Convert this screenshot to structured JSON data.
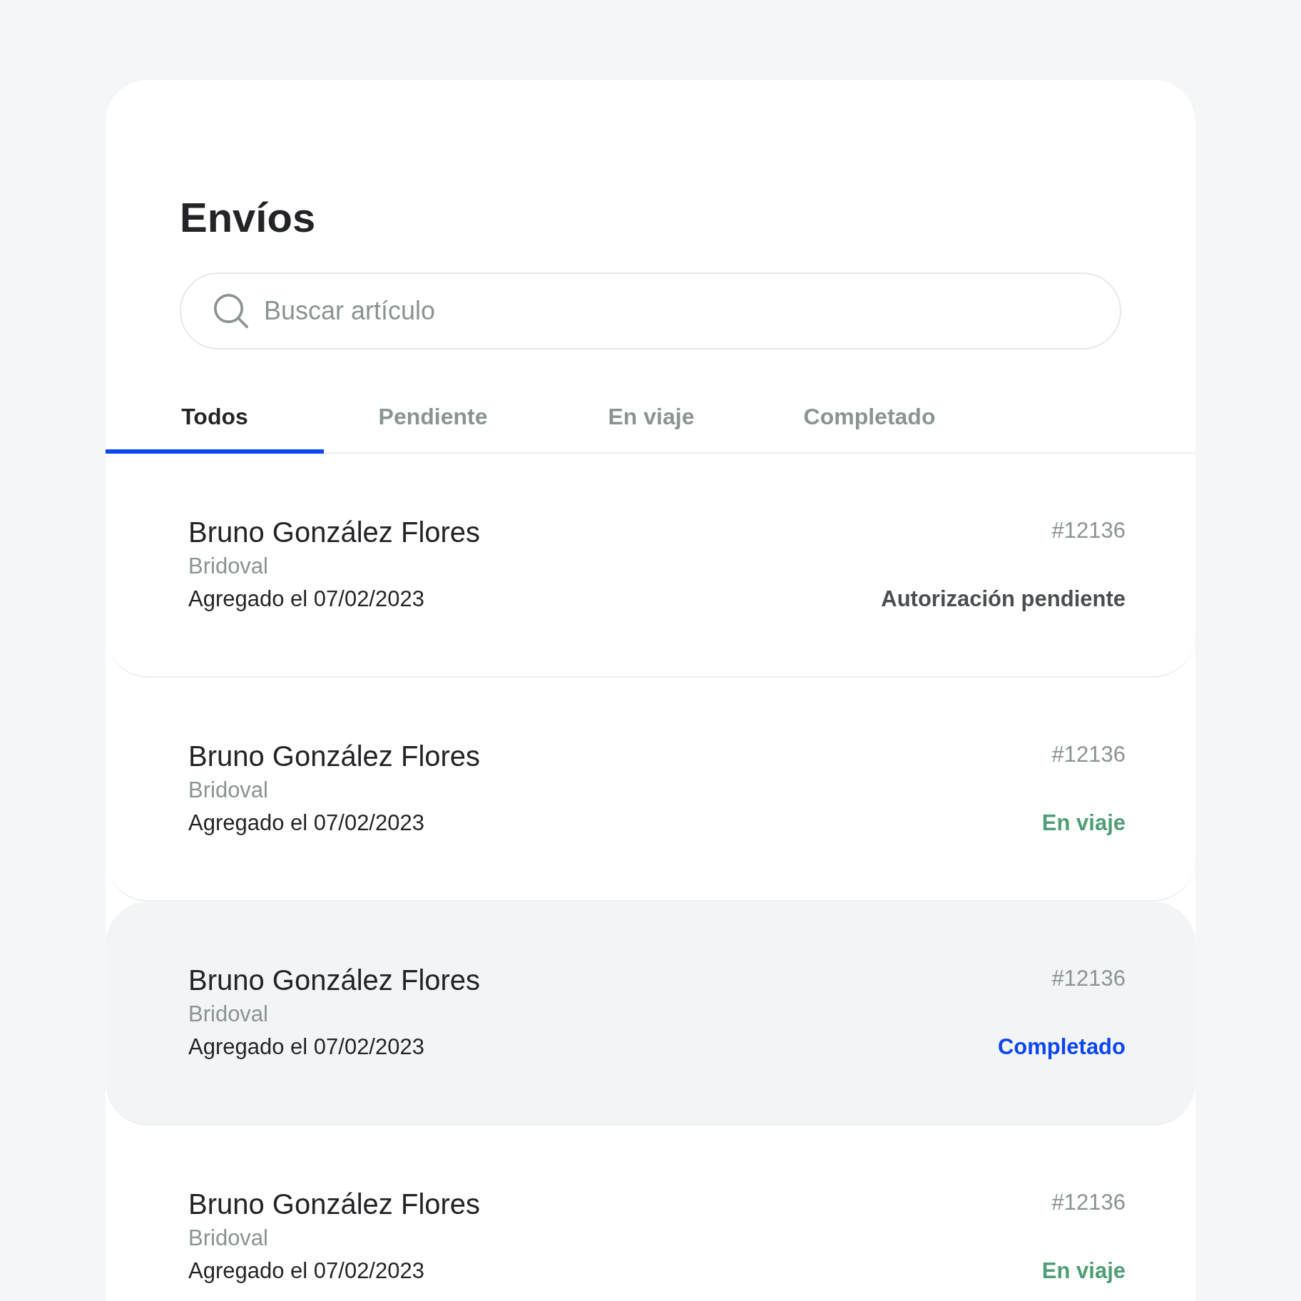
{
  "title": "Envíos",
  "search": {
    "placeholder": "Buscar artículo"
  },
  "tabs": [
    {
      "label": "Todos",
      "selected": true
    },
    {
      "label": "Pendiente",
      "selected": false
    },
    {
      "label": "En viaje",
      "selected": false
    },
    {
      "label": "Completado",
      "selected": false
    }
  ],
  "shipments": [
    {
      "name": "Bruno González Flores",
      "company": "Bridoval",
      "date": "Agregado el 07/02/2023",
      "number": "#12136",
      "status": "Autorización pendiente",
      "kind": "pending",
      "selected": false
    },
    {
      "name": "Bruno González Flores",
      "company": "Bridoval",
      "date": "Agregado el 07/02/2023",
      "number": "#12136",
      "status": "En viaje",
      "kind": "transit",
      "selected": false
    },
    {
      "name": "Bruno González Flores",
      "company": "Bridoval",
      "date": "Agregado el 07/02/2023",
      "number": "#12136",
      "status": "Completado",
      "kind": "completed",
      "selected": true
    },
    {
      "name": "Bruno González Flores",
      "company": "Bridoval",
      "date": "Agregado el 07/02/2023",
      "number": "#12136",
      "status": "En viaje",
      "kind": "transit",
      "selected": false
    }
  ]
}
